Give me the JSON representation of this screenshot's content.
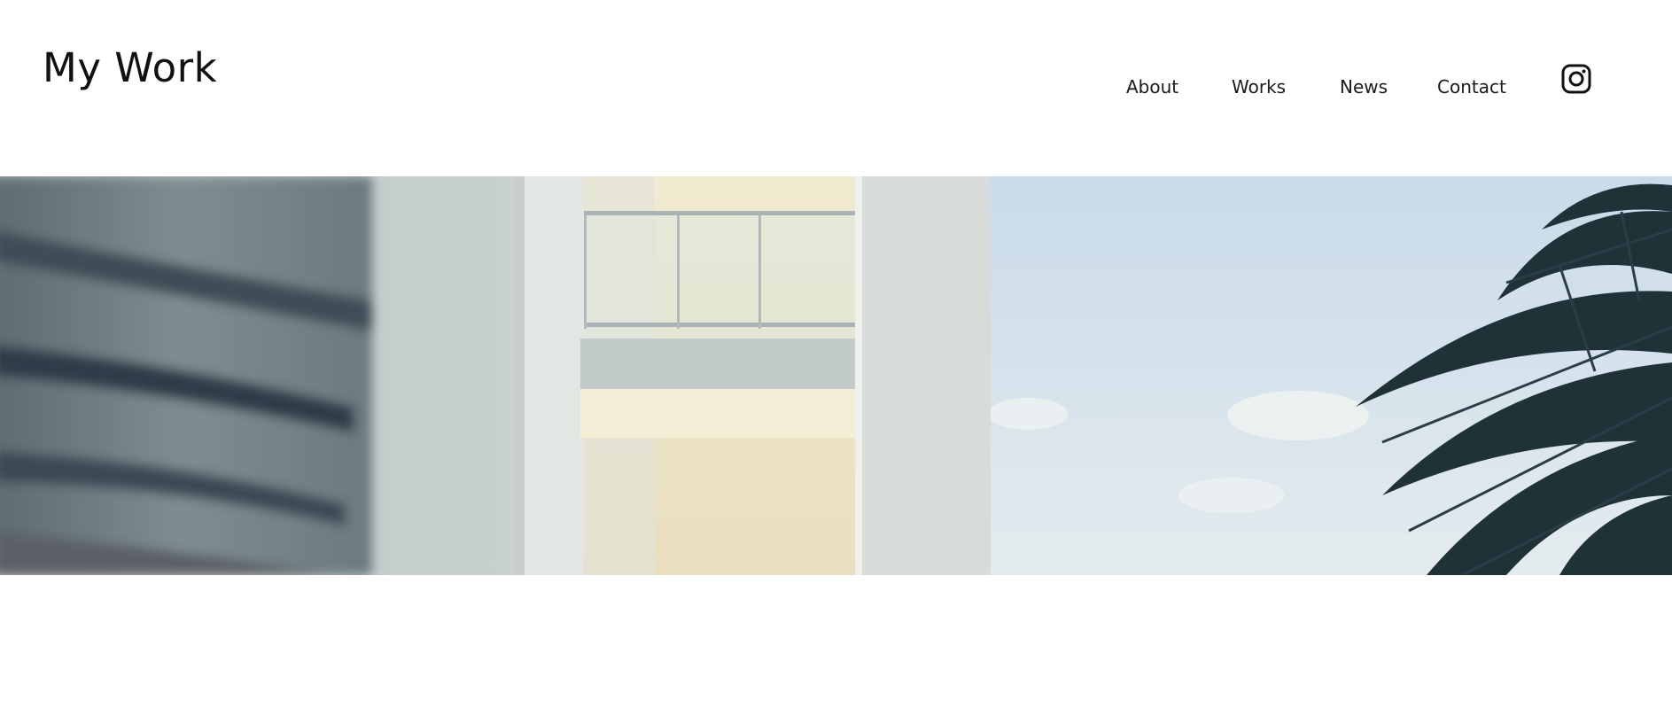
{
  "header": {
    "site_title": "My Work"
  },
  "nav": {
    "items": [
      {
        "label": "About"
      },
      {
        "label": "Works"
      },
      {
        "label": "News"
      },
      {
        "label": "Contact"
      }
    ],
    "social_icon": "instagram-icon"
  },
  "hero": {
    "image_subject": "white building balcony with palm tree and sky"
  },
  "colors": {
    "text": "#1a1a1a",
    "background": "#ffffff",
    "sky": "#d3e1ec",
    "wall": "#d9dedc",
    "palm": "#1f3238"
  }
}
